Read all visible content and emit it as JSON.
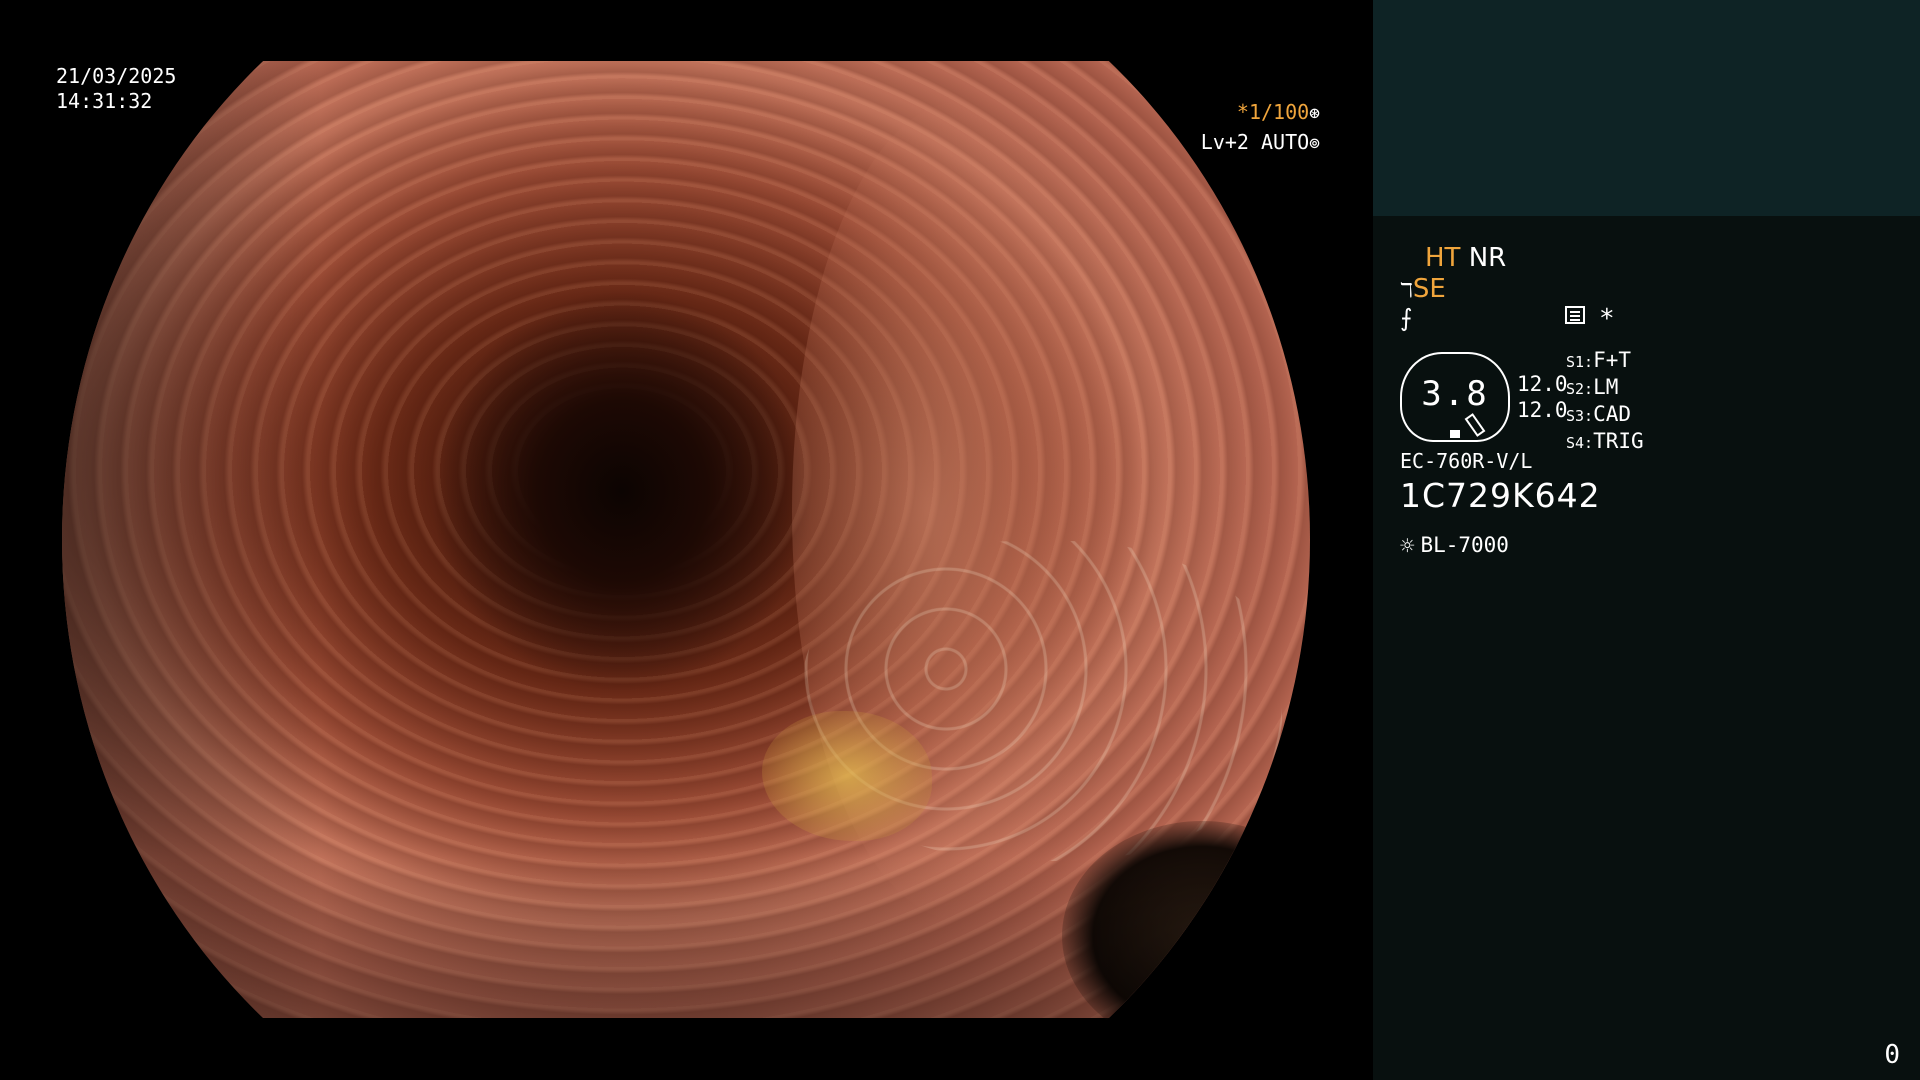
{
  "overlay": {
    "date": "21/03/2025",
    "time": "14:31:32",
    "shutter": "*1/100",
    "shutter_icon": "shutter-icon",
    "brightness": "Lv+2 AUTO",
    "brightness_icon": "iris-icon"
  },
  "panel": {
    "ht": "HT",
    "nr": "NR",
    "se": "SE",
    "se_icon": "enhance-icon",
    "mark_icon": "tone-icon",
    "menu_icon": "menu-icon",
    "star": "*",
    "gauge_value": "3.8",
    "value1": "12.0",
    "value2": "12.0",
    "switches": [
      {
        "key": "S1:",
        "label": "F+T"
      },
      {
        "key": "S2:",
        "label": "LM"
      },
      {
        "key": "S3:",
        "label": "CAD"
      },
      {
        "key": "S4:",
        "label": "TRIG"
      }
    ],
    "scope_model": "EC-760R-V/L",
    "serial": "1C729K642",
    "light_icon": "light-source-icon",
    "light_source": "BL-7000",
    "counter": "0"
  },
  "colors": {
    "accent_orange": "#f0a53c",
    "panel_bg": "#08100f",
    "panel_top_bg": "#0e2325"
  }
}
